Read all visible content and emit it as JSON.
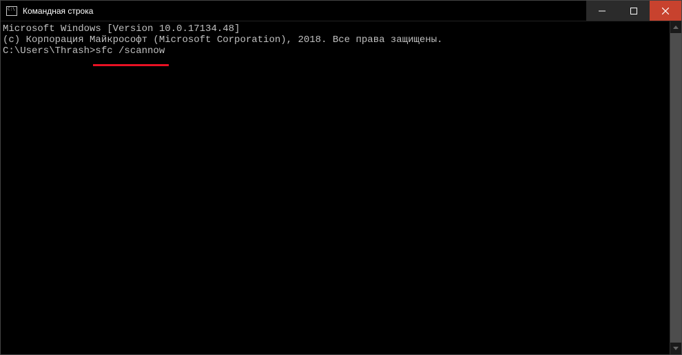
{
  "window": {
    "title": "Командная строка"
  },
  "console": {
    "line1": "Microsoft Windows [Version 10.0.17134.48]",
    "line2": "(c) Корпорация Майкрософт (Microsoft Corporation), 2018. Все права защищены.",
    "blank": "",
    "prompt": "C:\\Users\\Thrash>",
    "command": "sfc /scannow"
  }
}
